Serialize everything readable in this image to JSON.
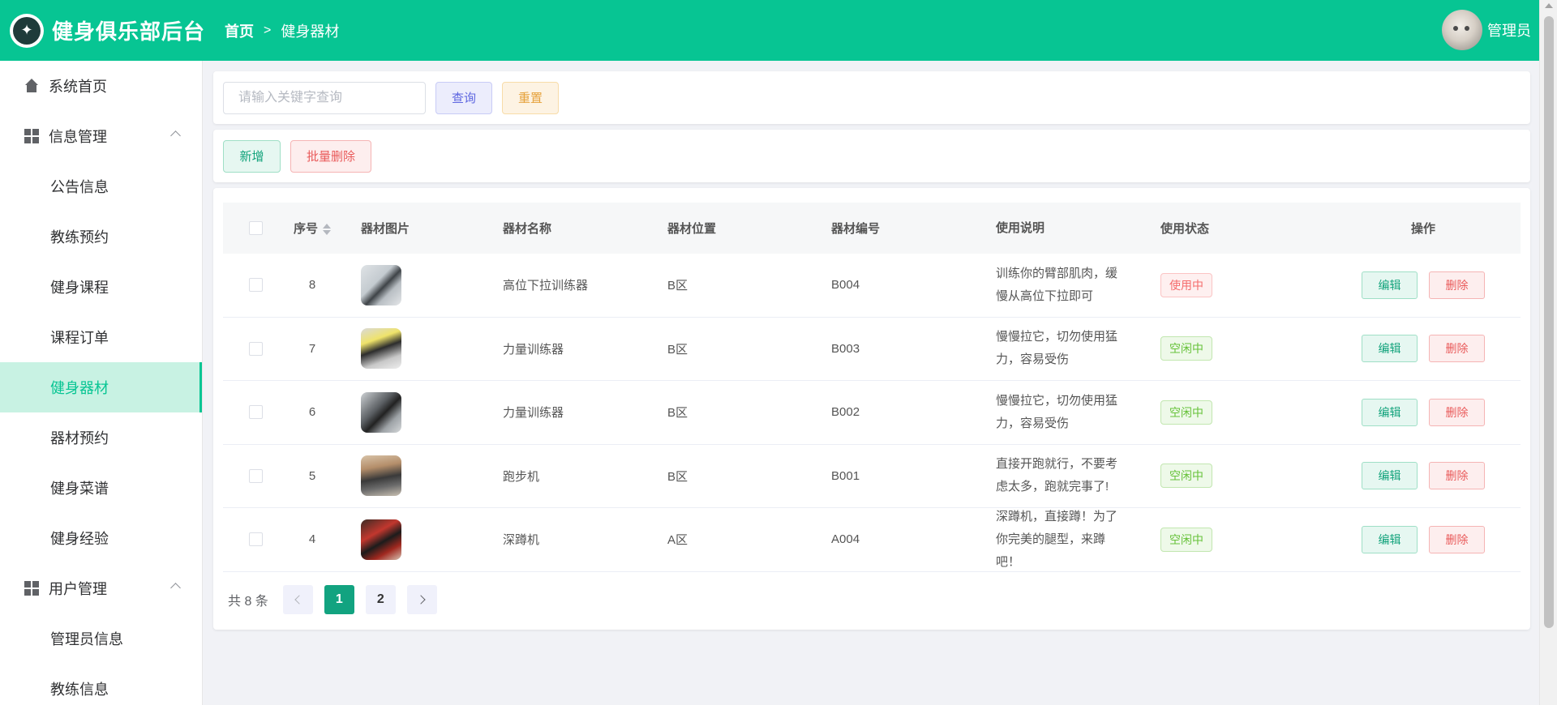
{
  "header": {
    "app_title": "健身俱乐部后台",
    "breadcrumb_home": "首页",
    "breadcrumb_current": "健身器材",
    "user_name": "管理员"
  },
  "sidebar": {
    "items": [
      {
        "label": "系统首页"
      },
      {
        "label": "信息管理"
      },
      {
        "label": "公告信息"
      },
      {
        "label": "教练预约"
      },
      {
        "label": "健身课程"
      },
      {
        "label": "课程订单"
      },
      {
        "label": "健身器材"
      },
      {
        "label": "器材预约"
      },
      {
        "label": "健身菜谱"
      },
      {
        "label": "健身经验"
      },
      {
        "label": "用户管理"
      },
      {
        "label": "管理员信息"
      },
      {
        "label": "教练信息"
      }
    ]
  },
  "search": {
    "placeholder": "请输入关键字查询",
    "query_label": "查询",
    "reset_label": "重置"
  },
  "actions": {
    "add_label": "新增",
    "batch_delete_label": "批量删除"
  },
  "table": {
    "headers": {
      "id": "序号",
      "image": "器材图片",
      "name": "器材名称",
      "position": "器材位置",
      "code": "器材编号",
      "description": "使用说明",
      "status": "使用状态",
      "operation": "操作"
    },
    "rows": [
      {
        "id": "8",
        "name": "高位下拉训练器",
        "position": "B区",
        "code": "B004",
        "description": "训练你的臂部肌肉，缓慢从高位下拉即可",
        "status": "使用中"
      },
      {
        "id": "7",
        "name": "力量训练器",
        "position": "B区",
        "code": "B003",
        "description": "慢慢拉它，切勿使用猛力，容易受伤",
        "status": "空闲中"
      },
      {
        "id": "6",
        "name": "力量训练器",
        "position": "B区",
        "code": "B002",
        "description": "慢慢拉它，切勿使用猛力，容易受伤",
        "status": "空闲中"
      },
      {
        "id": "5",
        "name": "跑步机",
        "position": "B区",
        "code": "B001",
        "description": "直接开跑就行，不要考虑太多，跑就完事了!",
        "status": "空闲中"
      },
      {
        "id": "4",
        "name": "深蹲机",
        "position": "A区",
        "code": "A004",
        "description": "深蹲机，直接蹲！为了你完美的腿型，来蹲吧！",
        "status": "空闲中"
      }
    ],
    "edit_label": "编辑",
    "delete_label": "删除"
  },
  "pagination": {
    "total_text": "共 8 条",
    "pages": [
      "1",
      "2"
    ],
    "current_page": "1"
  },
  "colors": {
    "primary": "#07c593",
    "active_menu_bg": "#c8f2e3"
  }
}
